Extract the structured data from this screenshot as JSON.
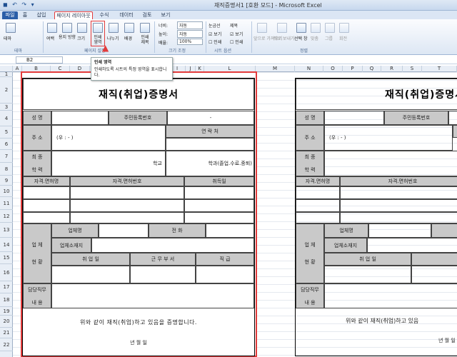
{
  "titlebar": {
    "title": "재직증명서1 [호환 모드] - Microsoft Excel",
    "quick_access": "◼ ↶ ↷ ▾"
  },
  "tabs": [
    "홈",
    "삽입",
    "페이지 레이아웃",
    "수식",
    "데이터",
    "검토",
    "보기"
  ],
  "file_tab": "파일",
  "ribbon": {
    "buttons": [
      "테마",
      "여백",
      "용지 방향",
      "크기",
      "인쇄 영역",
      "나누기",
      "배경",
      "인쇄 제목"
    ],
    "width_label": "너비:",
    "width_value": "자동",
    "height_label": "높이:",
    "height_value": "자동",
    "scale_label": "배율:",
    "scale_value": "100%",
    "gridlines": "눈금선",
    "headings": "제목",
    "view": "보기",
    "print": "인쇄",
    "arrange": [
      "앞으로 가져오기",
      "뒤로 보내기",
      "선택 창",
      "맞춤",
      "그룹",
      "회전"
    ],
    "groups": [
      "테마",
      "페이지 설정",
      "크기 조정",
      "시트 옵션",
      "정렬"
    ]
  },
  "namebox": "B2",
  "tooltip": {
    "title": "인쇄 영역",
    "desc": "인쇄하도록 시트의 특정 영역을 표시합니다."
  },
  "columns": [
    "A",
    "B",
    "C",
    "D",
    "E",
    "F",
    "G",
    "H",
    "I",
    "J",
    "K",
    "L",
    "M",
    "N",
    "O",
    "P",
    "Q",
    "R",
    "S",
    "T"
  ],
  "rows": [
    "1",
    "2",
    "3",
    "4",
    "5",
    "6",
    "7",
    "8",
    "9",
    "10",
    "11",
    "12",
    "13",
    "14",
    "15",
    "16",
    "17",
    "18",
    "19",
    "20",
    "21",
    "22"
  ],
  "form": {
    "title": "재직(취업)증명서",
    "name": "성    명",
    "rrn": "주민등록번호",
    "rrn_value": "-",
    "address": "주    소",
    "address_value": "(우 :    -    )",
    "contact": "연    락    처",
    "edu1": "최    종",
    "edu2": "학    력",
    "school": "학교",
    "dept": "학과(졸업.수료.중퇴)",
    "cert": "자격.면허명",
    "cert_no": "자격.면허번호",
    "acq_date": "취득일",
    "job1": "업    체",
    "job2": "현    황",
    "company": "업체명",
    "phone": "전    화",
    "comp_addr": "업체소재지",
    "hire": "취    업    일",
    "dept_work": "근  무  부  서",
    "rank": "직        급",
    "duty1": "담당직무",
    "duty2": "내    용",
    "certify": "위와 같이 재직(취업)하고 있음을 증명합니다.",
    "date": "년    월    일",
    "certify2": "위와 같이 재직(취업)하고 있음"
  }
}
